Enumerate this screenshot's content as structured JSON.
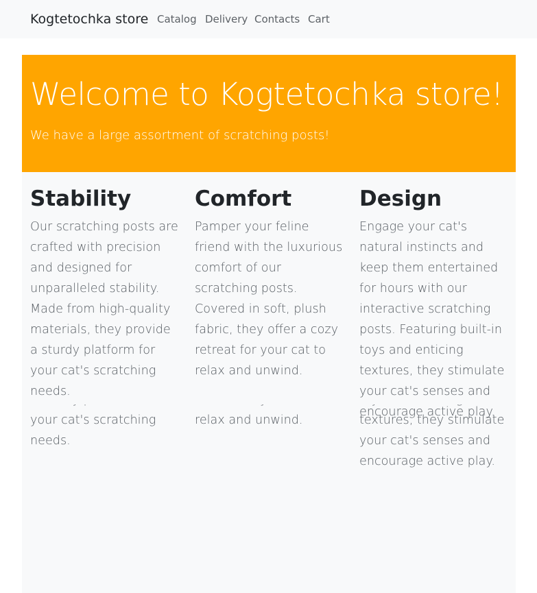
{
  "navbar": {
    "brand": "Kogtetochka store",
    "links": [
      {
        "label": "Catalog"
      },
      {
        "label": "Delivery"
      },
      {
        "label": "Contacts"
      },
      {
        "label": "Cart"
      }
    ]
  },
  "hero": {
    "title": "Welcome to Kogtetochka store!",
    "subtitle": "We have a large assortment of scratching posts!",
    "background": "#ffa500"
  },
  "features": [
    {
      "title": "Stability",
      "text": "Our scratching posts are crafted with precision and designed for unparalleled stability. Made from high-quality materials, they provide a sturdy platform for your cat's scratching needs."
    },
    {
      "title": "Comfort",
      "text": "Pamper your feline friend with the luxurious comfort of our scratching posts. Covered in soft, plush fabric, they offer a cozy retreat for your cat to relax and unwind."
    },
    {
      "title": "Design",
      "text": "Engage your cat's natural instincts and keep them entertained for hours with our interactive scratching posts. Featuring built-in toys and enticing textures, they stimulate your cat's senses and encourage active play."
    }
  ]
}
